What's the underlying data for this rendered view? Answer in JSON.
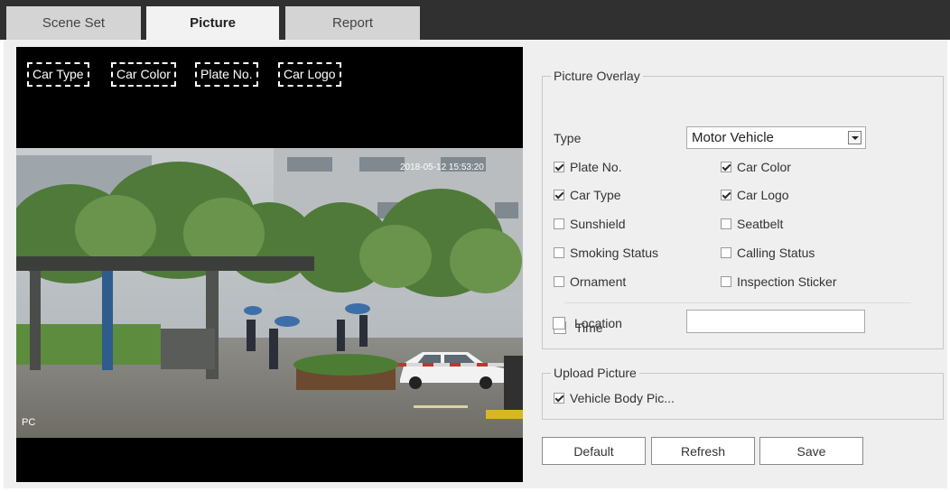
{
  "tabs": [
    {
      "label": "Scene Set",
      "active": false
    },
    {
      "label": "Picture",
      "active": true
    },
    {
      "label": "Report",
      "active": false
    }
  ],
  "preview": {
    "overlay_tags": [
      "Car Type",
      "Car Color",
      "Plate No.",
      "Car Logo"
    ],
    "timestamp": "2018-05-12 15:53:20",
    "corner_text": "PC"
  },
  "picture_overlay": {
    "legend": "Picture Overlay",
    "type_label": "Type",
    "type_value": "Motor Vehicle",
    "checkboxes": [
      {
        "label": "Plate No.",
        "checked": true
      },
      {
        "label": "Car Color",
        "checked": true
      },
      {
        "label": "Car Type",
        "checked": true
      },
      {
        "label": "Car Logo",
        "checked": true
      },
      {
        "label": "Sunshield",
        "checked": false
      },
      {
        "label": "Seatbelt",
        "checked": false
      },
      {
        "label": "Smoking Status",
        "checked": false
      },
      {
        "label": "Calling Status",
        "checked": false
      },
      {
        "label": "Ornament",
        "checked": false
      },
      {
        "label": "Inspection Sticker",
        "checked": false
      }
    ],
    "time_label": "Time",
    "time_checked": false,
    "location_label": "Location",
    "location_checked": false,
    "location_value": ""
  },
  "upload_picture": {
    "legend": "Upload Picture",
    "label": "Vehicle Body Pic...",
    "checked": true
  },
  "buttons": {
    "default": "Default",
    "refresh": "Refresh",
    "save": "Save"
  }
}
